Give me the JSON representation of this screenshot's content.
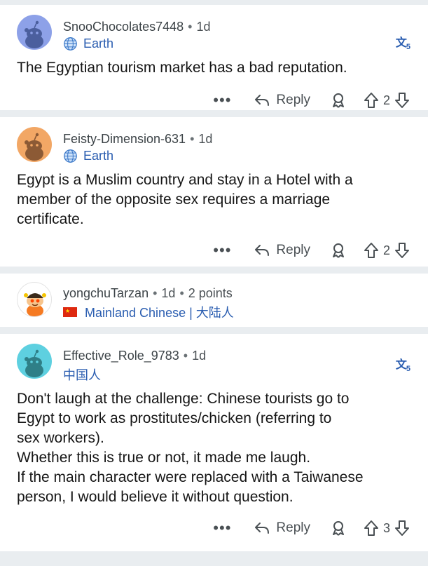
{
  "comments": [
    {
      "username": "SnooChocolates7448",
      "age": "1d",
      "flair": "Earth",
      "flair_type": "globe",
      "avatar_color": "#8da1e8",
      "has_translate": true,
      "body": "The Egyptian tourism market has a bad reputation.",
      "reply_label": "Reply",
      "votes": "2"
    },
    {
      "username": "Feisty-Dimension-631",
      "age": "1d",
      "flair": "Earth",
      "flair_type": "globe",
      "avatar_color": "#f2a765",
      "has_translate": false,
      "body": "Egypt is a Muslim country and stay in a Hotel with a\nmember of the opposite sex requires a marriage\ncertificate.",
      "reply_label": "Reply",
      "votes": "2"
    },
    {
      "username": "yongchuTarzan",
      "age": "1d",
      "points": "2 points",
      "flair": "Mainland Chinese | 大陆人",
      "flair_type": "flag",
      "avatar_color": "#ffffff",
      "has_translate": false
    },
    {
      "username": "Effective_Role_9783",
      "age": "1d",
      "flair": "中国人",
      "flair_type": "none",
      "avatar_color": "#5ed0e0",
      "has_translate": true,
      "body": "Don't laugh at the challenge: Chinese tourists go to\nEgypt to work as prostitutes/chicken (referring to\nsex workers).\nWhether this is true or not, it made me laugh.\nIf the main character were replaced with a Taiwanese\nperson, I would believe it without question.",
      "reply_label": "Reply",
      "votes": "3"
    }
  ],
  "more_glyph": "•••",
  "translate_glyph": "文",
  "translate_sub": "5",
  "dot": "•"
}
